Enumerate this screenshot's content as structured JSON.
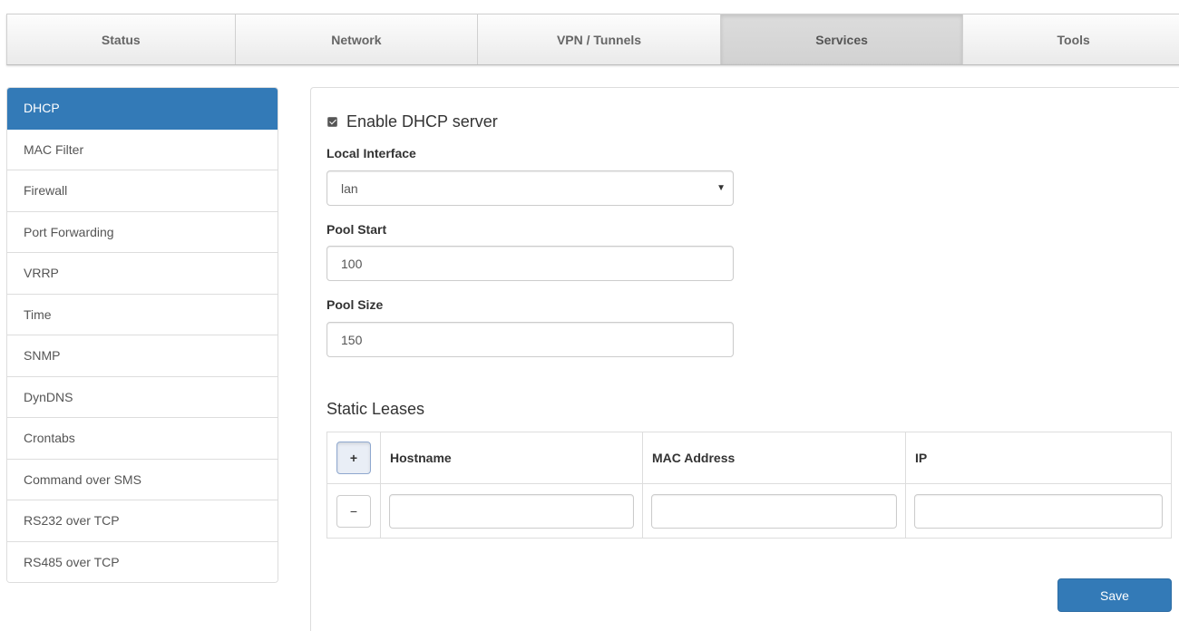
{
  "topnav": {
    "tabs": [
      "Status",
      "Network",
      "VPN / Tunnels",
      "Services",
      "Tools"
    ],
    "active": "Services"
  },
  "sidebar": {
    "items": [
      "DHCP",
      "MAC Filter",
      "Firewall",
      "Port Forwarding",
      "VRRP",
      "Time",
      "SNMP",
      "DynDNS",
      "Crontabs",
      "Command over SMS",
      "RS232 over TCP",
      "RS485 over TCP"
    ],
    "active": "DHCP"
  },
  "dhcp": {
    "enable_label": "Enable DHCP server",
    "enabled": true,
    "local_interface_label": "Local Interface",
    "local_interface_value": "lan",
    "pool_start_label": "Pool Start",
    "pool_start_value": "100",
    "pool_size_label": "Pool Size",
    "pool_size_value": "150"
  },
  "static_leases": {
    "title": "Static Leases",
    "add_label": "+",
    "remove_label": "−",
    "columns": [
      "Hostname",
      "MAC Address",
      "IP"
    ],
    "rows": [
      [
        "",
        "",
        ""
      ]
    ]
  },
  "actions": {
    "save_label": "Save"
  },
  "colors": {
    "accent": "#337ab7"
  }
}
